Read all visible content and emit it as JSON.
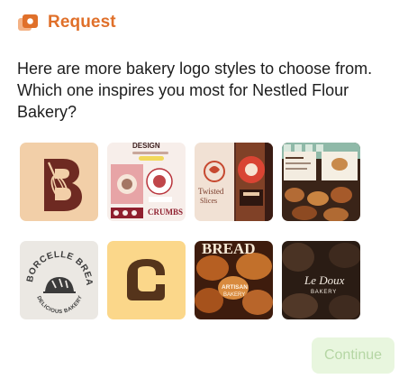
{
  "header": {
    "title": "Request",
    "icon": "request-cards-icon",
    "accent_color": "#e0702a"
  },
  "prompt": {
    "text": "Here are more bakery logo styles to choose from. Which one inspires you most for Nestled Flour Bakery?"
  },
  "options": [
    {
      "id": "logo-option-1",
      "style": "letter-b-whisk"
    },
    {
      "id": "logo-option-2",
      "style": "design-sheet-crumbs",
      "texts": [
        "DESIGN",
        "CRUMBS"
      ]
    },
    {
      "id": "logo-option-3",
      "style": "twisted-slices",
      "texts": [
        "Twisted",
        "Slices"
      ]
    },
    {
      "id": "logo-option-4",
      "style": "bakery-menu-photo"
    },
    {
      "id": "logo-option-5",
      "style": "borcelle-bread-badge",
      "texts": [
        "BORCELLE BREAD",
        "DELICIOUS BAKERY"
      ]
    },
    {
      "id": "logo-option-6",
      "style": "toast-c-mark"
    },
    {
      "id": "logo-option-7",
      "style": "bread-photo-artisan",
      "texts": [
        "BREAD",
        "ARTISAN",
        "BAKERY"
      ]
    },
    {
      "id": "logo-option-8",
      "style": "le-doux-bakery",
      "texts": [
        "Le Doux",
        "BAKERY"
      ]
    }
  ],
  "actions": {
    "continue_label": "Continue",
    "continue_bg": "#e8f6de",
    "continue_fg": "#b5d6a4"
  }
}
